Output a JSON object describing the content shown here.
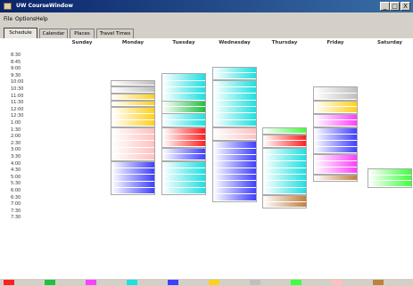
{
  "window": {
    "title": "UW CourseWindow",
    "controls": [
      "_",
      "□",
      "X"
    ]
  },
  "menu": [
    "File",
    "Options",
    "Help"
  ],
  "tabs": [
    {
      "label": "Schedule",
      "active": true
    },
    {
      "label": "Calendar",
      "active": false
    },
    {
      "label": "Places",
      "active": false
    },
    {
      "label": "Travel Times",
      "active": false
    }
  ],
  "days": [
    "Sunday",
    "Monday",
    "Tuesday",
    "Wednesday",
    "Thursday",
    "Friday",
    "Saturday"
  ],
  "times": [
    "8:30",
    "8:45",
    "9:00",
    "9:30",
    "10:00",
    "10:30",
    "11:00",
    "11:30",
    "12:00",
    "12:30",
    "1:00",
    "1:30",
    "2:00",
    "2:30",
    "3:00",
    "3:30",
    "4:00",
    "4:30",
    "5:00",
    "5:30",
    "6:00",
    "6:30",
    "7:00",
    "7:30",
    "7:30"
  ],
  "legend": [
    {
      "label": "",
      "color": "#ff2020"
    },
    {
      "label": "",
      "color": "#20c040"
    },
    {
      "label": "",
      "color": "#ff40ff"
    },
    {
      "label": "",
      "color": "#20e0e0"
    },
    {
      "label": "",
      "color": "#4040ff"
    },
    {
      "label": "",
      "color": "#ffd020"
    },
    {
      "label": "",
      "color": "#c0c0c0"
    },
    {
      "label": "",
      "color": "#40ff40"
    },
    {
      "label": "",
      "color": "#ffc0c0"
    },
    {
      "label": "",
      "color": "#c08040"
    }
  ],
  "schedule": [
    {
      "day": 1,
      "start": 3,
      "end": 4,
      "color": "#c0c0c0"
    },
    {
      "day": 1,
      "start": 4,
      "end": 5,
      "color": "#c0c0c0"
    },
    {
      "day": 1,
      "start": 5,
      "end": 6,
      "color": "#ffd020"
    },
    {
      "day": 1,
      "start": 6,
      "end": 7,
      "color": "#ffd020"
    },
    {
      "day": 1,
      "start": 7,
      "end": 10,
      "color": "#ffd020"
    },
    {
      "day": 1,
      "start": 10,
      "end": 15,
      "color": "#ffc0c0"
    },
    {
      "day": 1,
      "start": 15,
      "end": 20,
      "color": "#4040ff"
    },
    {
      "day": 2,
      "start": 2,
      "end": 10,
      "color": "#20e0e0"
    },
    {
      "day": 2,
      "start": 6,
      "end": 8,
      "color": "#20c040"
    },
    {
      "day": 2,
      "start": 10,
      "end": 13,
      "color": "#ff2020"
    },
    {
      "day": 2,
      "start": 13,
      "end": 15,
      "color": "#4040ff"
    },
    {
      "day": 2,
      "start": 15,
      "end": 20,
      "color": "#20e0e0"
    },
    {
      "day": 3,
      "start": 1,
      "end": 3,
      "color": "#20e0e0"
    },
    {
      "day": 3,
      "start": 3,
      "end": 10,
      "color": "#20e0e0"
    },
    {
      "day": 3,
      "start": 10,
      "end": 12,
      "color": "#ffc0c0"
    },
    {
      "day": 3,
      "start": 12,
      "end": 21,
      "color": "#4040ff"
    },
    {
      "day": 4,
      "start": 10,
      "end": 11,
      "color": "#40ff40"
    },
    {
      "day": 4,
      "start": 11,
      "end": 13,
      "color": "#ff2020"
    },
    {
      "day": 4,
      "start": 13,
      "end": 20,
      "color": "#20e0e0"
    },
    {
      "day": 4,
      "start": 20,
      "end": 22,
      "color": "#c08040"
    },
    {
      "day": 5,
      "start": 4,
      "end": 6,
      "color": "#c0c0c0"
    },
    {
      "day": 5,
      "start": 6,
      "end": 8,
      "color": "#ffd020"
    },
    {
      "day": 5,
      "start": 8,
      "end": 10,
      "color": "#ff40ff"
    },
    {
      "day": 5,
      "start": 10,
      "end": 14,
      "color": "#4040ff"
    },
    {
      "day": 5,
      "start": 14,
      "end": 17,
      "color": "#ff40ff"
    },
    {
      "day": 5,
      "start": 17,
      "end": 18,
      "color": "#c08040"
    },
    {
      "day": 6,
      "start": 16,
      "end": 19,
      "color": "#40ff40"
    }
  ]
}
